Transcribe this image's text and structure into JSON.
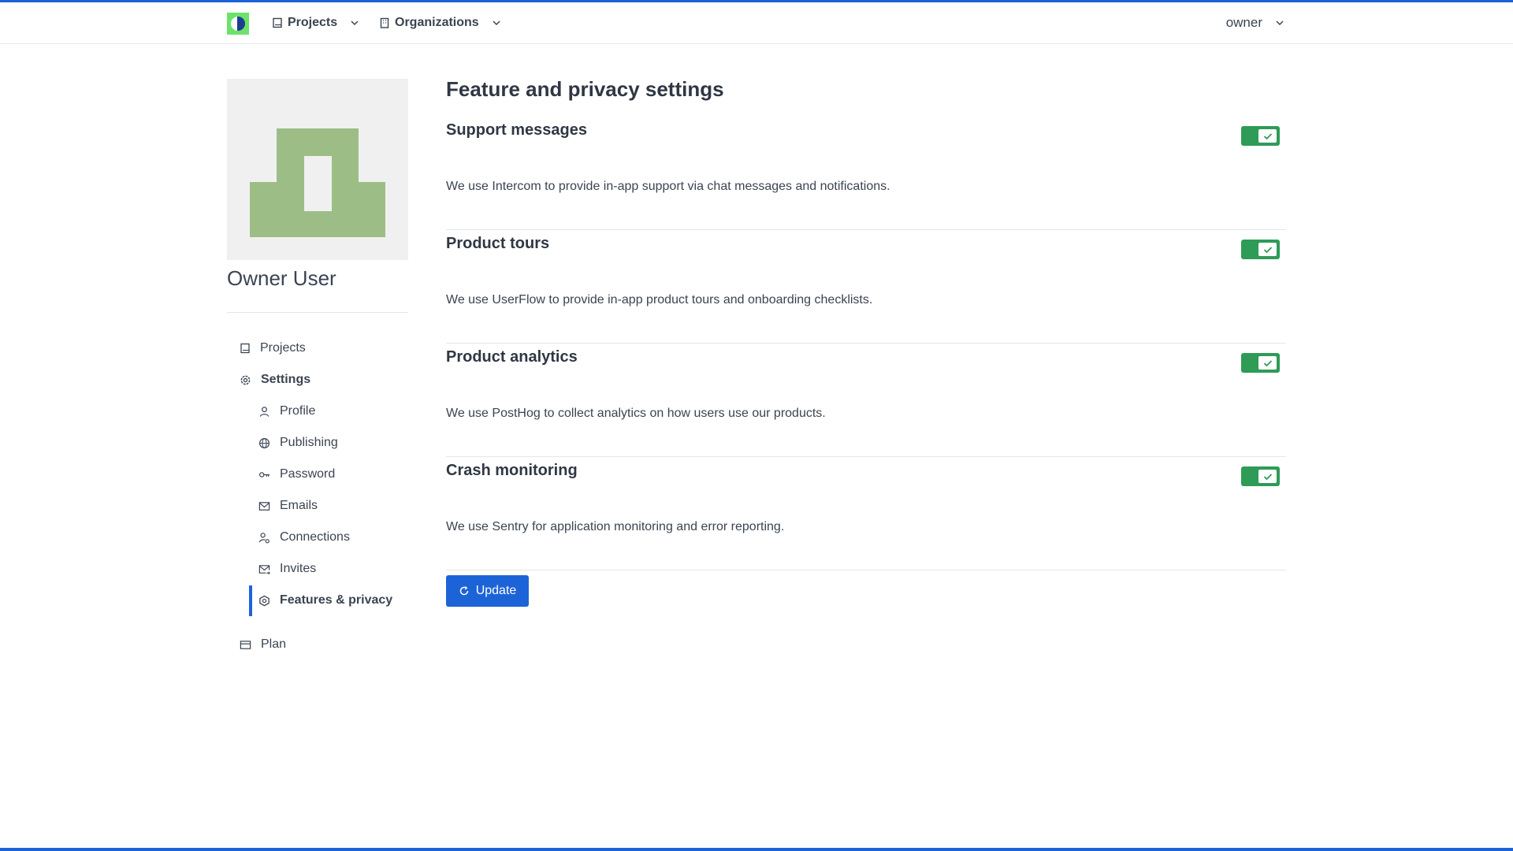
{
  "header": {
    "nav": [
      {
        "label": "Projects",
        "icon": "book-icon"
      },
      {
        "label": "Organizations",
        "icon": "building-icon"
      }
    ],
    "user_menu": {
      "label": "owner"
    }
  },
  "sidebar": {
    "user_name": "Owner User",
    "items": [
      {
        "label": "Projects",
        "icon": "book-icon"
      },
      {
        "label": "Settings",
        "icon": "gear-icon"
      },
      {
        "label": "Profile",
        "icon": "user-icon"
      },
      {
        "label": "Publishing",
        "icon": "globe-icon"
      },
      {
        "label": "Password",
        "icon": "key-icon"
      },
      {
        "label": "Emails",
        "icon": "mail-icon"
      },
      {
        "label": "Connections",
        "icon": "user-link-icon"
      },
      {
        "label": "Invites",
        "icon": "mail-send-icon"
      },
      {
        "label": "Features & privacy",
        "icon": "shield-icon"
      },
      {
        "label": "Plan",
        "icon": "credit-card-icon"
      }
    ],
    "active_item": "Features & privacy"
  },
  "main": {
    "title": "Feature and privacy settings",
    "sections": [
      {
        "title": "Support messages",
        "description": "We use Intercom to provide in-app support via chat messages and notifications.",
        "enabled": true
      },
      {
        "title": "Product tours",
        "description": "We use UserFlow to provide in-app product tours and onboarding checklists.",
        "enabled": true
      },
      {
        "title": "Product analytics",
        "description": "We use PostHog to collect analytics on how users use our products.",
        "enabled": true
      },
      {
        "title": "Crash monitoring",
        "description": "We use Sentry for application monitoring and error reporting.",
        "enabled": true
      }
    ],
    "update_button": {
      "label": "Update",
      "icon": "refresh-icon"
    }
  },
  "colors": {
    "accent": "#1d63d8",
    "toggle_on": "#2e9b57",
    "avatar_fill": "#9dbd87",
    "logo_green": "#6be36b"
  }
}
